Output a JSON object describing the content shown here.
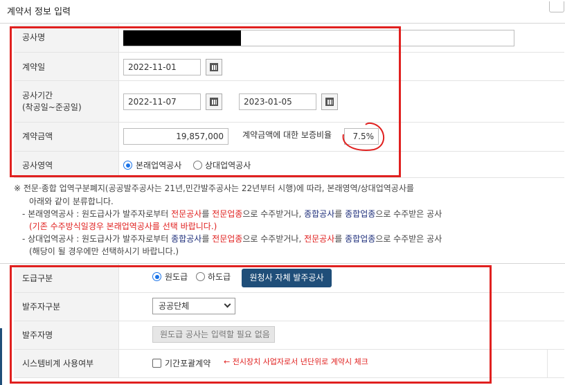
{
  "title": "계약서 정보 입력",
  "fields": {
    "project_name": {
      "label": "공사명"
    },
    "contract_date": {
      "label": "계약일",
      "value": "2022-11-01"
    },
    "period": {
      "label_line1": "공사기간",
      "label_line2": "(착공일~준공일)",
      "start": "2022-11-07",
      "end": "2023-01-05"
    },
    "amount": {
      "label": "계약금액",
      "value": "19,857,000",
      "guarantee_label": "계약금액에 대한 보증비율",
      "guarantee_value": "7.5%"
    },
    "area": {
      "label": "공사영역",
      "options": [
        "본래업역공사",
        "상대업역공사"
      ],
      "selected": 0
    }
  },
  "notes": {
    "line1": "※ 전문·종합 업역구분폐지(공공발주공사는 21년,민간발주공사는 22년부터 시행)에 따라, 본래영역/상대업역공사를",
    "line2": "아래와 같이 분류합니다.",
    "b1_prefix": "- 본래영역공사 : 원도급사가 발주자로부터 ",
    "b1_t1": "전문공사",
    "b1_m1": "를 ",
    "b1_t2": "전문업종",
    "b1_m2": "으로 수주받거나, ",
    "b1_t3": "종합공사",
    "b1_m3": "를 ",
    "b1_t4": "종합업종",
    "b1_suffix": "으로 수주받은 공사",
    "b1_sub": "(기존 수주방식일경우 본래업역공사를 선택 바랍니다.)",
    "b2_prefix": "- 상대업역공사 : 원도급사가 발주자로부터 ",
    "b2_t1": "종합공사",
    "b2_m1": "를 ",
    "b2_t2": "전문업종",
    "b2_m2": "으로 수주받거나, ",
    "b2_t3": "전문공사",
    "b2_m3": "를 ",
    "b2_t4": "종합업종",
    "b2_suffix": "으로 수주받은 공사",
    "b2_sub": "(해당이 될 경우에만 선택하시기 바랍니다.)"
  },
  "lower": {
    "contract_type": {
      "label": "도급구분",
      "options": [
        "원도급",
        "하도급"
      ],
      "selected": 0,
      "button": "원청사 자체 발주공사"
    },
    "client_type": {
      "label": "발주자구분",
      "selected": "공공단체"
    },
    "client_name": {
      "label": "발주자명",
      "placeholder": "원도급 공사는 입력할 필요 없음"
    },
    "system": {
      "label": "시스템비계 사용여부",
      "checkbox_label": "기간포괄계약",
      "hint": "← 전시장치 사업자로서 년단위로 계약시 체크"
    }
  },
  "colors": {
    "highlight_box": "#e0201f",
    "primary_button": "#1f4e79",
    "radio_selected": "#1a73e8"
  },
  "icons": [
    "calendar-icon",
    "chevron-down-icon"
  ]
}
